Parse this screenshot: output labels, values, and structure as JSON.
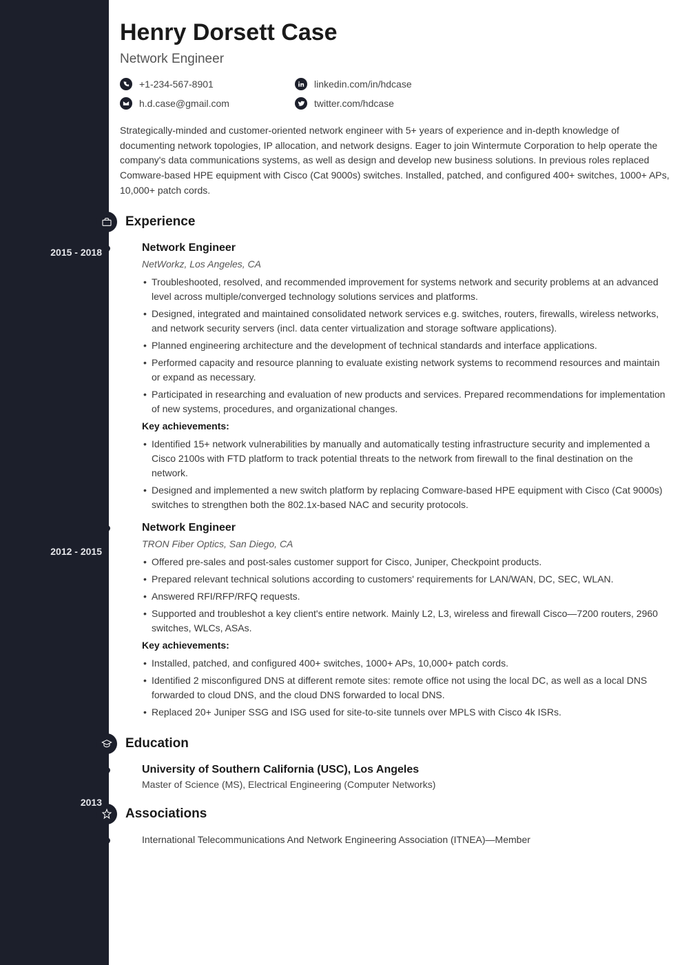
{
  "name": "Henry Dorsett Case",
  "title": "Network Engineer",
  "contacts": {
    "phone": "+1-234-567-8901",
    "linkedin": "linkedin.com/in/hdcase",
    "email": "h.d.case@gmail.com",
    "twitter": "twitter.com/hdcase"
  },
  "summary": "Strategically-minded and customer-oriented network engineer with 5+ years of experience and in-depth knowledge of documenting network topologies, IP allocation, and network designs. Eager to join Wintermute Corporation to help operate the company's data communications systems, as well as design and develop new business solutions. In previous roles replaced Comware-based HPE equipment with Cisco (Cat 9000s) switches. Installed, patched, and configured 400+ switches, 1000+ APs, 10,000+ patch cords.",
  "sections": {
    "experience": {
      "heading": "Experience",
      "items": [
        {
          "dates": "2015 - 2018",
          "role": "Network Engineer",
          "company": "NetWorkz, Los Angeles, CA",
          "bullets": [
            "Troubleshooted, resolved, and recommended improvement for systems network and security problems at an advanced level across multiple/converged technology solutions services and platforms.",
            "Designed, integrated and maintained consolidated network services e.g. switches, routers, firewalls, wireless networks, and network security servers (incl. data center virtualization and storage software applications).",
            "Planned engineering architecture and the development of technical standards and interface applications.",
            "Performed capacity and resource planning to evaluate existing network systems to recommend resources and maintain or expand as necessary.",
            "Participated in researching and evaluation of new products and services. Prepared recommendations for implementation of new systems, procedures, and organizational changes."
          ],
          "ka_label": "Key achievements:",
          "achievements": [
            "Identified 15+ network vulnerabilities by manually and automatically testing infrastructure security and implemented a Cisco 2100s with FTD platform to track potential threats to the network from firewall to the final destination on the network.",
            "Designed and implemented a new switch platform by replacing Comware-based HPE equipment with Cisco (Cat 9000s) switches to strengthen both the 802.1x-based NAC and security protocols."
          ]
        },
        {
          "dates": "2012 - 2015",
          "role": "Network Engineer",
          "company": "TRON Fiber Optics, San Diego, CA",
          "bullets": [
            "Offered pre-sales and post-sales customer support for Cisco, Juniper, Checkpoint products.",
            "Prepared relevant technical solutions according to customers' requirements for LAN/WAN, DC, SEC, WLAN.",
            "Answered RFI/RFP/RFQ requests.",
            "Supported and troubleshot a key client's entire network. Mainly L2, L3, wireless and firewall Cisco—7200 routers, 2960 switches, WLCs, ASAs."
          ],
          "ka_label": "Key achievements:",
          "achievements": [
            "Installed, patched, and configured 400+ switches, 1000+ APs, 10,000+ patch cords.",
            "Identified 2 misconfigured DNS at different remote sites: remote office not using the local DC, as well as a local DNS forwarded to cloud DNS, and the cloud DNS forwarded to local DNS.",
            "Replaced 20+ Juniper SSG and ISG used for site-to-site tunnels over MPLS with Cisco 4k ISRs."
          ]
        }
      ]
    },
    "education": {
      "heading": "Education",
      "items": [
        {
          "dates": "2013",
          "school": "University of Southern California (USC), Los Angeles",
          "degree": "Master of Science (MS), Electrical Engineering (Computer Networks)"
        }
      ]
    },
    "associations": {
      "heading": "Associations",
      "text": "International Telecommunications And Network Engineering Association (ITNEA)—Member"
    }
  }
}
